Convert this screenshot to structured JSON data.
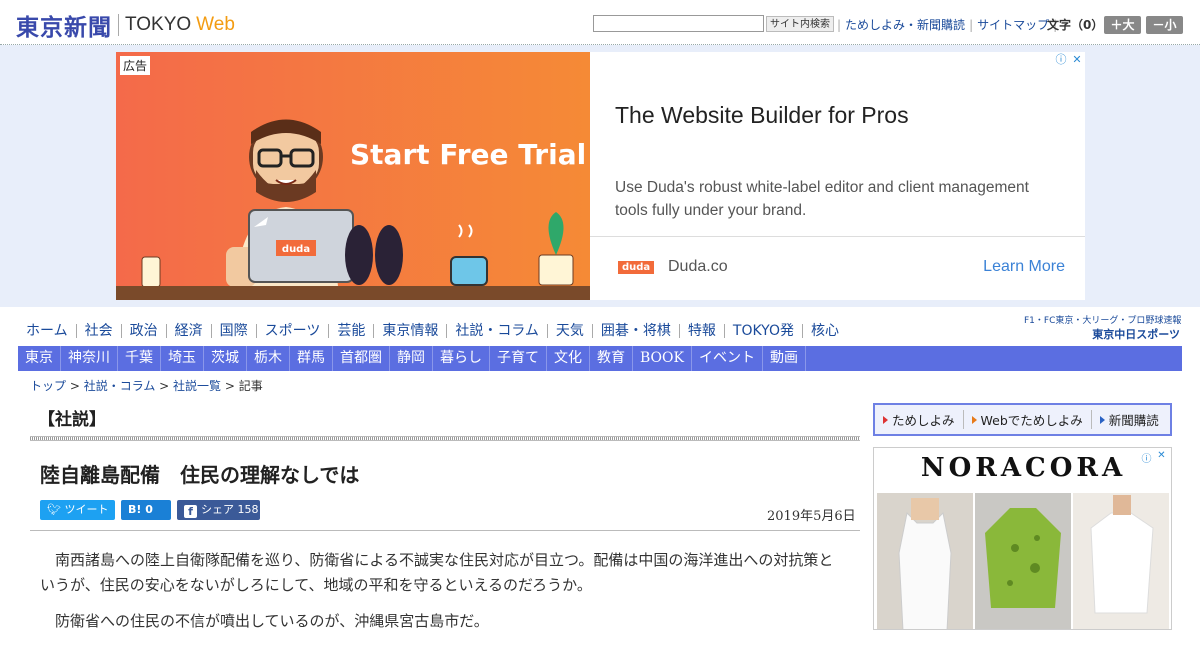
{
  "header": {
    "logo_jp": "東京新聞",
    "logo_tokyo": "TOKYO",
    "logo_web": "Web",
    "search_placeholder": "",
    "search_button": "サイト内検索",
    "links": [
      "ためしよみ・新聞購読",
      "サイトマップ"
    ],
    "font_size_label": "文字（0）",
    "font_up": "＋大",
    "font_down": "－小"
  },
  "ad": {
    "label": "広告",
    "banner_cta": "Start Free Trial",
    "badge": "duda",
    "title": "The Website Builder for Pros",
    "description": "Use Duda's robust white-label editor and client management tools fully under your brand.",
    "domain": "Duda.co",
    "cta": "Learn More"
  },
  "nav_main": [
    "ホーム",
    "社会",
    "政治",
    "経済",
    "国際",
    "スポーツ",
    "芸能",
    "東京情報",
    "社説・コラム",
    "天気",
    "囲碁・将棋",
    "特報",
    "TOKYO発",
    "核心"
  ],
  "chunichi": {
    "line1": "F1・FC東京・大リーグ・プロ野球速報",
    "line2": "東京中日スポーツ"
  },
  "nav_regions": [
    "東京",
    "神奈川",
    "千葉",
    "埼玉",
    "茨城",
    "栃木",
    "群馬",
    "首都圏",
    "静岡",
    "暮らし",
    "子育て",
    "文化",
    "教育",
    "BOOK",
    "イベント",
    "動画"
  ],
  "breadcrumb": {
    "items": [
      "トップ",
      "社説・コラム",
      "社説一覧"
    ],
    "current": "記事"
  },
  "article": {
    "section": "【社説】",
    "headline": "陸自離島配備　住民の理解なしでは",
    "share": {
      "tweet": "ツイート",
      "hatena": "B! 0",
      "facebook": "シェア 158"
    },
    "date": "2019年5月6日",
    "paragraphs": [
      "南西諸島への陸上自衛隊配備を巡り、防衛省による不誠実な住民対応が目立つ。配備は中国の海洋進出への対抗策というが、住民の安心をないがしろにして、地域の平和を守るといえるのだろうか。",
      "防衛省への住民の不信が噴出しているのが、沖縄県宮古島市だ。"
    ]
  },
  "sidebar": {
    "links": [
      "ためしよみ",
      "Webでためしよみ",
      "新聞購読"
    ],
    "ad_brand": "NORACORA"
  },
  "colors": {
    "brand": "#3949ab",
    "nav_bar": "#5b6ee1",
    "ad_orange": "#f46d43",
    "link": "#1a4a9a"
  }
}
